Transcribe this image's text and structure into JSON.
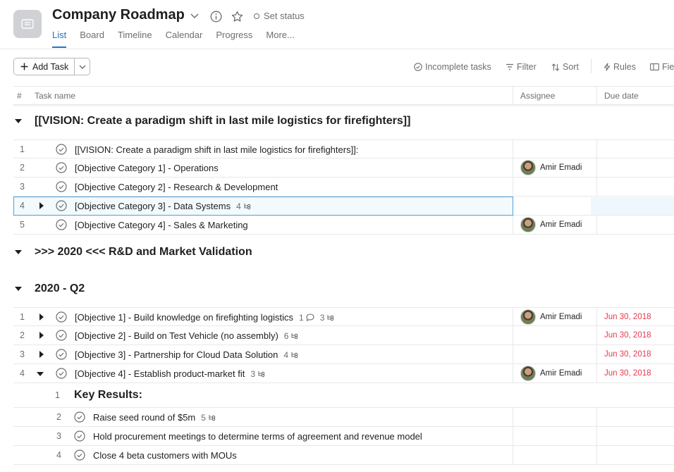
{
  "header": {
    "title": "Company Roadmap",
    "set_status": "Set status",
    "tabs": [
      "List",
      "Board",
      "Timeline",
      "Calendar",
      "Progress",
      "More..."
    ]
  },
  "toolbar": {
    "add_task": "Add Task",
    "incomplete": "Incomplete tasks",
    "filter": "Filter",
    "sort": "Sort",
    "rules": "Rules",
    "fields": "Fie"
  },
  "columns": {
    "num": "#",
    "task": "Task name",
    "assignee": "Assignee",
    "due": "Due date"
  },
  "sections": [
    {
      "title": "[[VISION: Create a paradigm shift in last mile logistics for firefighters]]",
      "rows": [
        {
          "num": "1",
          "name": "[[VISION: Create a paradigm shift in last mile logistics for firefighters]]:",
          "assignee": "",
          "due": ""
        },
        {
          "num": "2",
          "name": "[Objective Category 1] - Operations",
          "assignee": "Amir Emadi",
          "due": ""
        },
        {
          "num": "3",
          "name": "[Objective Category 2] - Research & Development",
          "assignee": "",
          "due": ""
        },
        {
          "num": "4",
          "name": "[Objective Category 3] - Data Systems",
          "subtasks": "4",
          "assignee": "",
          "due": ""
        },
        {
          "num": "5",
          "name": "[Objective Category 4] - Sales & Marketing",
          "assignee": "Amir Emadi",
          "due": ""
        }
      ]
    },
    {
      "title": ">>> 2020 <<< R&D and Market Validation",
      "rows": []
    },
    {
      "title": "2020 - Q2",
      "rows": [
        {
          "num": "1",
          "name": "[Objective 1] - Build knowledge on firefighting logistics",
          "comments": "1",
          "subtasks": "3",
          "assignee": "Amir Emadi",
          "due": "Jun 30, 2018"
        },
        {
          "num": "2",
          "name": "[Objective 2] - Build on Test Vehicle (no assembly)",
          "subtasks": "6",
          "assignee": "",
          "due": "Jun 30, 2018"
        },
        {
          "num": "3",
          "name": "[Objective 3] - Partnership for Cloud Data Solution",
          "subtasks": "4",
          "assignee": "",
          "due": "Jun 30, 2018"
        },
        {
          "num": "4",
          "name": "[Objective 4] - Establish product-market fit",
          "subtasks": "3",
          "assignee": "Amir Emadi",
          "due": "Jun 30, 2018"
        }
      ],
      "subtasks": [
        {
          "num": "1",
          "name": "Key Results:"
        },
        {
          "num": "2",
          "name": "Raise seed round of $5m",
          "subtasks": "5"
        },
        {
          "num": "3",
          "name": "Hold procurement meetings to determine terms of agreement and revenue model"
        },
        {
          "num": "4",
          "name": "Close 4 beta customers with MOUs"
        }
      ]
    }
  ],
  "colors": {
    "accent": "#1f76c2",
    "due_overdue": "#e8384f",
    "selected_border": "#4da1d6"
  }
}
